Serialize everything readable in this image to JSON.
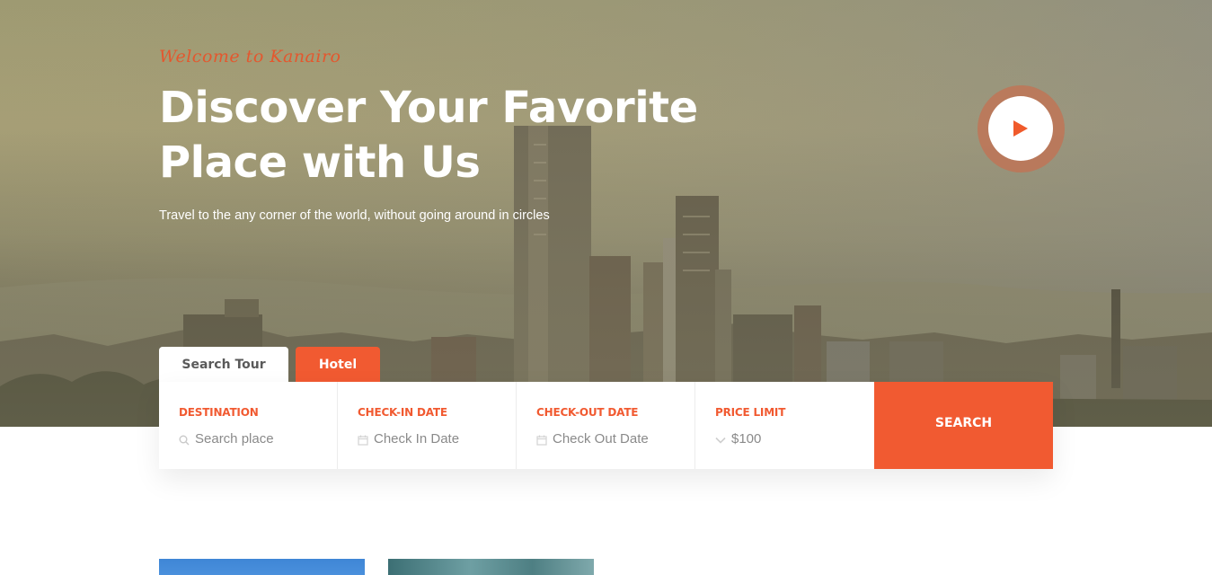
{
  "hero": {
    "welcome": "Welcome to Kanairo",
    "title_line1": "Discover Your Favorite",
    "title_line2": "Place with Us",
    "subtitle": "Travel to the any corner of the world, without going around in circles",
    "play_icon": "play-icon"
  },
  "tabs": [
    {
      "label": "Search Tour",
      "active": true
    },
    {
      "label": "Hotel",
      "active": false
    }
  ],
  "search": {
    "fields": [
      {
        "label": "DESTINATION",
        "placeholder": "Search place",
        "icon": "search-icon"
      },
      {
        "label": "CHECK-IN DATE",
        "placeholder": "Check In Date",
        "icon": "calendar-icon"
      },
      {
        "label": "CHECK-OUT DATE",
        "placeholder": "Check Out Date",
        "icon": "calendar-icon"
      },
      {
        "label": "PRICE LIMIT",
        "value": "$100",
        "icon": "chevron-down-icon"
      }
    ],
    "button": "SEARCH"
  },
  "colors": {
    "accent": "#f15a31",
    "white": "#ffffff"
  }
}
